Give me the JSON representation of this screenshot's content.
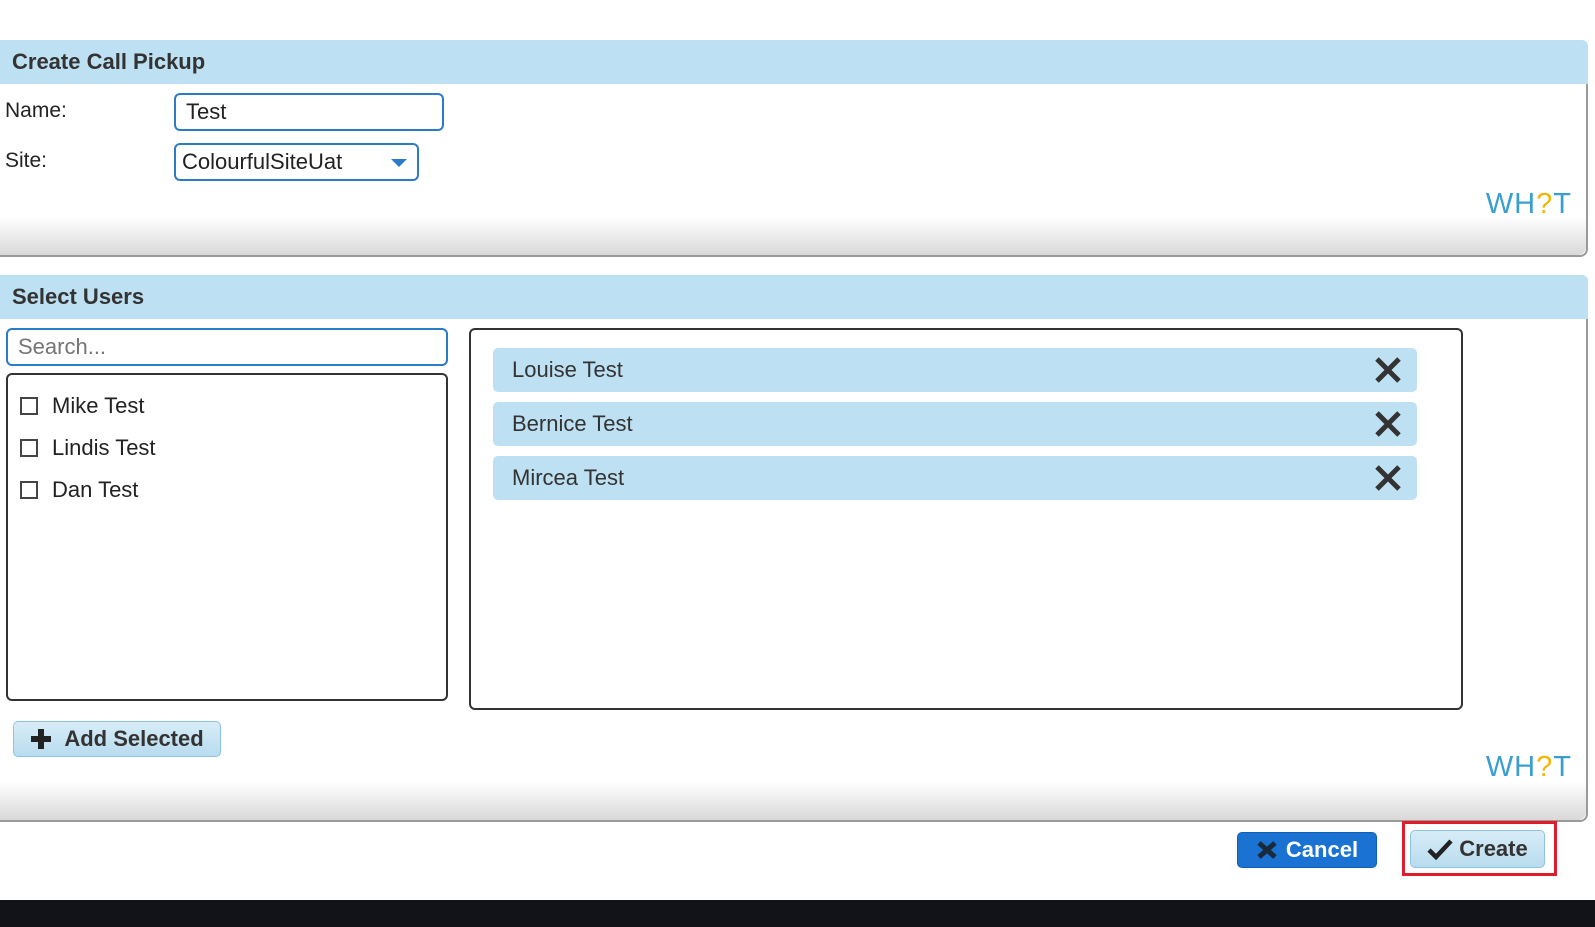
{
  "call_pickup": {
    "title": "Create Call Pickup",
    "name_label": "Name:",
    "name_value": "Test",
    "site_label": "Site:",
    "site_value": "ColourfulSiteUat",
    "help_logo": {
      "left": "WH",
      "q": "?",
      "right": "T"
    }
  },
  "select_users": {
    "title": "Select Users",
    "search_placeholder": "Search...",
    "available_users": [
      {
        "name": "Mike Test",
        "checked": false
      },
      {
        "name": "Lindis Test",
        "checked": false
      },
      {
        "name": "Dan Test",
        "checked": false
      }
    ],
    "selected_users": [
      "Louise Test",
      "Bernice Test",
      "Mircea Test"
    ],
    "add_selected_label": "Add Selected",
    "help_logo": {
      "left": "WH",
      "q": "?",
      "right": "T"
    }
  },
  "actions": {
    "cancel_label": "Cancel",
    "create_label": "Create"
  },
  "colors": {
    "header_bg": "#bde0f2",
    "accent": "#2b7bc6",
    "primary_button": "#1a73d3",
    "highlight": "#e21b2a",
    "logo_blue": "#3a9fd0",
    "logo_yellow": "#f2b705"
  }
}
